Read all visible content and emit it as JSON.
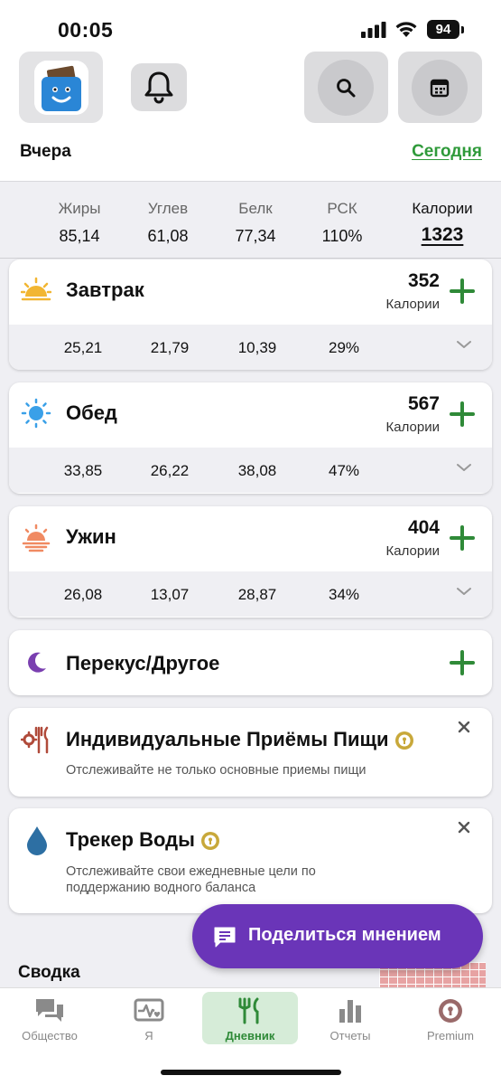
{
  "status": {
    "time": "00:05",
    "battery": "94"
  },
  "header": {
    "prev_day": "Вчера",
    "today": "Сегодня"
  },
  "summary": [
    {
      "label": "Жиры",
      "value": "85,14"
    },
    {
      "label": "Углев",
      "value": "61,08"
    },
    {
      "label": "Белк",
      "value": "77,34"
    },
    {
      "label": "РСК",
      "value": "110%"
    },
    {
      "label": "Калории",
      "value": "1323"
    }
  ],
  "meals": [
    {
      "name": "Завтрак",
      "calories": "352",
      "cal_label": "Калории",
      "fat": "25,21",
      "carbs": "21,79",
      "protein": "10,39",
      "rdi": "29%"
    },
    {
      "name": "Обед",
      "calories": "567",
      "cal_label": "Калории",
      "fat": "33,85",
      "carbs": "26,22",
      "protein": "38,08",
      "rdi": "47%"
    },
    {
      "name": "Ужин",
      "calories": "404",
      "cal_label": "Калории",
      "fat": "26,08",
      "carbs": "13,07",
      "protein": "28,87",
      "rdi": "34%"
    }
  ],
  "snack": {
    "name": "Перекус/Другое"
  },
  "promos": [
    {
      "title": "Индивидуальные Приёмы Пищи",
      "desc": "Отслеживайте не только основные приемы пищи"
    },
    {
      "title": "Трекер Воды",
      "desc": "Отслеживайте свои ежедневные цели по поддержанию водного баланса"
    }
  ],
  "section_title": "Сводка",
  "feedback_button": "Поделиться мнением",
  "tabs": [
    {
      "label": "Общество",
      "icon": "chat-bubbles-icon"
    },
    {
      "label": "Я",
      "icon": "heart-monitor-icon"
    },
    {
      "label": "Дневник",
      "icon": "fork-knife-icon"
    },
    {
      "label": "Отчеты",
      "icon": "bar-chart-icon"
    },
    {
      "label": "Premium",
      "icon": "premium-lock-icon"
    }
  ],
  "colors": {
    "accent_green": "#2f9a3a",
    "feedback_purple": "#6a35b8",
    "active_tab_bg": "#d6ecd8"
  }
}
